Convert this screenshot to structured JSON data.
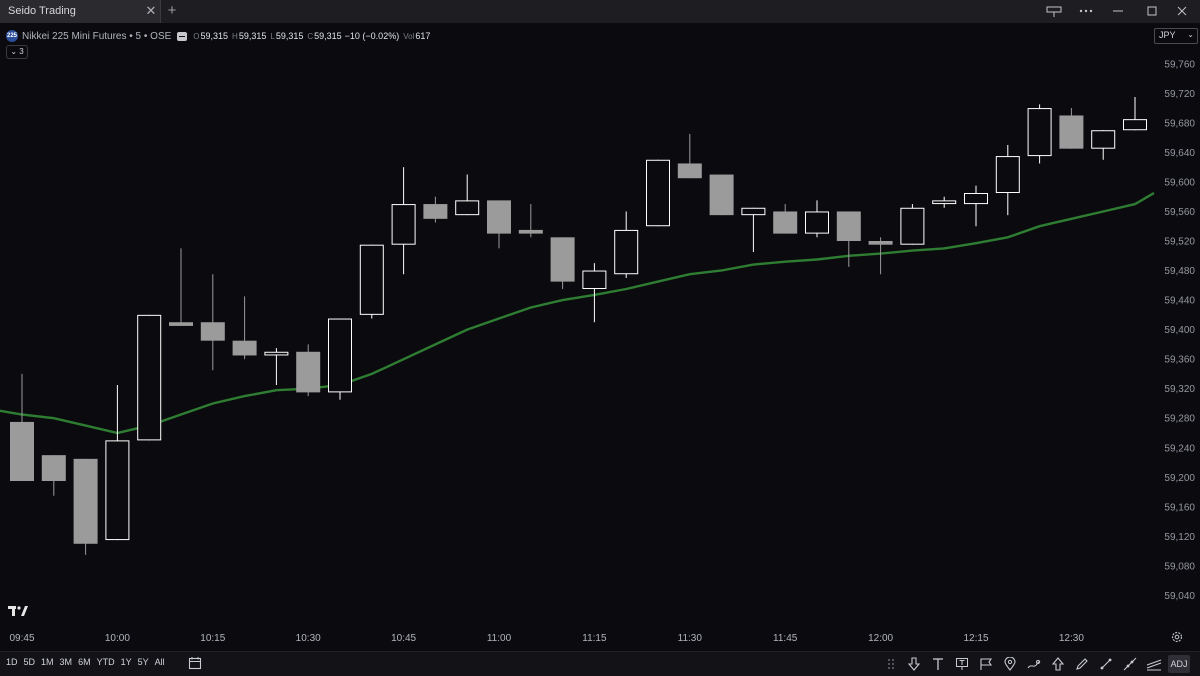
{
  "window": {
    "tab_title": "Seido Trading",
    "tab_close_icon": "close-icon",
    "new_tab_icon": "plus-icon",
    "controls": [
      "layout-icon",
      "more-icon",
      "minimize-icon",
      "maximize-icon",
      "close-icon"
    ]
  },
  "legend": {
    "logo_text": "225",
    "title": "Nikkei 225 Mini Futures • 5 • OSE",
    "open_label": "O",
    "open": "59,315",
    "high_label": "H",
    "high": "59,315",
    "low_label": "L",
    "low": "59,315",
    "close_label": "C",
    "close": "59,315",
    "change": "−10 (−0.02%)",
    "volume_label": "Vol",
    "volume": "617",
    "collapse_label": "⌄ 3"
  },
  "currency": {
    "label": "JPY",
    "caret": "⌄"
  },
  "colors": {
    "background": "#0b0b0f",
    "up_candle": "#ffffff",
    "down_candle": "#9b9b9b",
    "moving_average": "#2e7d32",
    "text": "#d1d4dc"
  },
  "chart_data": {
    "type": "candlestick",
    "ylim": [
      59000,
      59780
    ],
    "y_ticks": [
      "59,760",
      "59,720",
      "59,680",
      "59,640",
      "59,600",
      "59,560",
      "59,520",
      "59,480",
      "59,440",
      "59,400",
      "59,360",
      "59,320",
      "59,280",
      "59,240",
      "59,200",
      "59,160",
      "59,120",
      "59,080",
      "59,040"
    ],
    "y_tick_values": [
      59760,
      59720,
      59680,
      59640,
      59600,
      59560,
      59520,
      59480,
      59440,
      59400,
      59360,
      59320,
      59280,
      59240,
      59200,
      59160,
      59120,
      59080,
      59040
    ],
    "x_ticks": [
      {
        "label": "09:45",
        "index": 0
      },
      {
        "label": "10:00",
        "index": 3
      },
      {
        "label": "10:15",
        "index": 6
      },
      {
        "label": "10:30",
        "index": 9
      },
      {
        "label": "10:45",
        "index": 12
      },
      {
        "label": "11:00",
        "index": 15
      },
      {
        "label": "11:15",
        "index": 18
      },
      {
        "label": "11:30",
        "index": 21
      },
      {
        "label": "11:45",
        "index": 24
      },
      {
        "label": "12:00",
        "index": 27
      },
      {
        "label": "12:15",
        "index": 30
      },
      {
        "label": "12:30",
        "index": 33
      }
    ],
    "candles": [
      {
        "o": 59275,
        "h": 59340,
        "l": 59195,
        "c": 59195
      },
      {
        "o": 59230,
        "h": 59230,
        "l": 59175,
        "c": 59195
      },
      {
        "o": 59225,
        "h": 59225,
        "l": 59095,
        "c": 59110
      },
      {
        "o": 59115,
        "h": 59325,
        "l": 59115,
        "c": 59250
      },
      {
        "o": 59250,
        "h": 59420,
        "l": 59250,
        "c": 59420
      },
      {
        "o": 59410,
        "h": 59510,
        "l": 59405,
        "c": 59405
      },
      {
        "o": 59410,
        "h": 59475,
        "l": 59345,
        "c": 59385
      },
      {
        "o": 59385,
        "h": 59445,
        "l": 59360,
        "c": 59365
      },
      {
        "o": 59365,
        "h": 59375,
        "l": 59325,
        "c": 59370
      },
      {
        "o": 59370,
        "h": 59380,
        "l": 59310,
        "c": 59315
      },
      {
        "o": 59315,
        "h": 59415,
        "l": 59305,
        "c": 59415
      },
      {
        "o": 59420,
        "h": 59515,
        "l": 59415,
        "c": 59515
      },
      {
        "o": 59515,
        "h": 59620,
        "l": 59475,
        "c": 59570
      },
      {
        "o": 59570,
        "h": 59580,
        "l": 59545,
        "c": 59550
      },
      {
        "o": 59555,
        "h": 59610,
        "l": 59555,
        "c": 59575
      },
      {
        "o": 59575,
        "h": 59575,
        "l": 59510,
        "c": 59530
      },
      {
        "o": 59535,
        "h": 59570,
        "l": 59525,
        "c": 59530
      },
      {
        "o": 59525,
        "h": 59525,
        "l": 59455,
        "c": 59465
      },
      {
        "o": 59455,
        "h": 59490,
        "l": 59410,
        "c": 59480
      },
      {
        "o": 59475,
        "h": 59560,
        "l": 59470,
        "c": 59535
      },
      {
        "o": 59540,
        "h": 59630,
        "l": 59540,
        "c": 59630
      },
      {
        "o": 59625,
        "h": 59665,
        "l": 59605,
        "c": 59605
      },
      {
        "o": 59610,
        "h": 59610,
        "l": 59555,
        "c": 59555
      },
      {
        "o": 59555,
        "h": 59565,
        "l": 59505,
        "c": 59565
      },
      {
        "o": 59560,
        "h": 59570,
        "l": 59530,
        "c": 59530
      },
      {
        "o": 59530,
        "h": 59575,
        "l": 59525,
        "c": 59560
      },
      {
        "o": 59560,
        "h": 59560,
        "l": 59485,
        "c": 59520
      },
      {
        "o": 59520,
        "h": 59525,
        "l": 59475,
        "c": 59515
      },
      {
        "o": 59515,
        "h": 59570,
        "l": 59515,
        "c": 59565
      },
      {
        "o": 59570,
        "h": 59580,
        "l": 59565,
        "c": 59575
      },
      {
        "o": 59570,
        "h": 59595,
        "l": 59540,
        "c": 59585
      },
      {
        "o": 59585,
        "h": 59650,
        "l": 59555,
        "c": 59635
      },
      {
        "o": 59635,
        "h": 59705,
        "l": 59625,
        "c": 59700
      },
      {
        "o": 59690,
        "h": 59700,
        "l": 59645,
        "c": 59645
      },
      {
        "o": 59645,
        "h": 59670,
        "l": 59630,
        "c": 59670
      },
      {
        "o": 59670,
        "h": 59715,
        "l": 59670,
        "c": 59685
      }
    ],
    "ma": [
      59285,
      59280,
      59270,
      59260,
      59270,
      59285,
      59300,
      59310,
      59318,
      59320,
      59325,
      59340,
      59360,
      59380,
      59400,
      59415,
      59430,
      59440,
      59447,
      59455,
      59465,
      59475,
      59480,
      59488,
      59492,
      59495,
      59500,
      59503,
      59507,
      59510,
      59517,
      59525,
      59540,
      59550,
      59560,
      59570
    ],
    "ma_last": 59585
  },
  "bottom": {
    "ranges": [
      "1D",
      "5D",
      "1M",
      "3M",
      "6M",
      "YTD",
      "1Y",
      "5Y",
      "All"
    ],
    "tools": [
      "arrow-down-icon",
      "text-icon",
      "note-icon",
      "flag-icon",
      "pin-icon",
      "brush-icon",
      "arrow-up-icon",
      "pencil-icon",
      "trend-line-icon",
      "ray-icon",
      "regression-icon"
    ],
    "adj_label": "ADJ"
  }
}
